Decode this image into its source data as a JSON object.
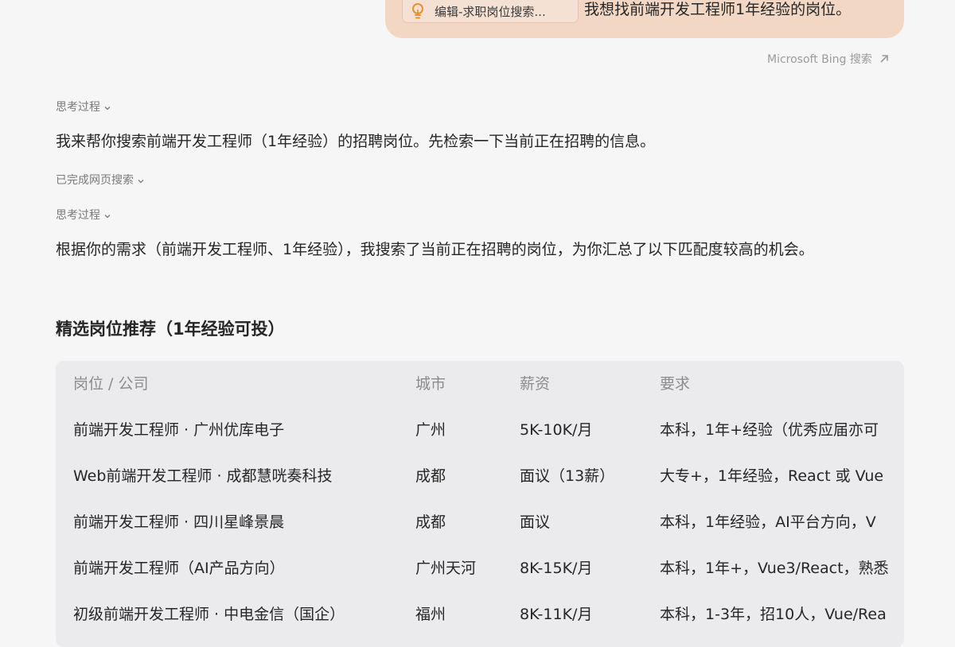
{
  "user_message": {
    "attachment_label": "编辑-求职岗位搜索...",
    "text": "我想找前端开发工程师1年经验的岗位。"
  },
  "search_source": {
    "label": "Microsoft Bing 搜索"
  },
  "assistant": {
    "thinking_toggle_1": "思考过程",
    "intro": "我来帮你搜索前端开发工程师（1年经验）的招聘岗位。先检索一下当前正在招聘的信息。",
    "search_status": "已完成网页搜索",
    "thinking_toggle_2": "思考过程",
    "summary": "根据你的需求（前端开发工程师、1年经验），我搜索了当前正在招聘的岗位，为你汇总了以下匹配度较高的机会。",
    "section_title": "精选岗位推荐（1年经验可投）"
  },
  "jobs_table": {
    "headers": [
      "岗位 / 公司",
      "城市",
      "薪资",
      "要求"
    ],
    "rows": [
      [
        "前端开发工程师 · 广州优库电子",
        "广州",
        "5K-10K/月",
        "本科，1年+经验（优秀应届亦可"
      ],
      [
        "Web前端开发工程师 · 成都慧咣奏科技",
        "成都",
        "面议（13薪）",
        "大专+，1年经验，React 或 Vue"
      ],
      [
        "前端开发工程师 · 四川星峰景晨",
        "成都",
        "面议",
        "本科，1年经验，AI平台方向，V"
      ],
      [
        "前端开发工程师（AI产品方向）",
        "广州天河",
        "8K-15K/月",
        "本科，1年+，Vue3/React，熟悉"
      ],
      [
        "初级前端开发工程师 · 中电金信（国企）",
        "福州",
        "8K-11K/月",
        "本科，1-3年，招10人，Vue/Rea"
      ]
    ]
  },
  "colors": {
    "user_bubble": "#f1d7c4",
    "page_background": "#f6f6f7",
    "table_background": "#ebebed",
    "bulb_icon": "#e8912d"
  },
  "icons": [
    "lightbulb-icon",
    "external-link-arrow-icon",
    "chevron-down-icon"
  ]
}
